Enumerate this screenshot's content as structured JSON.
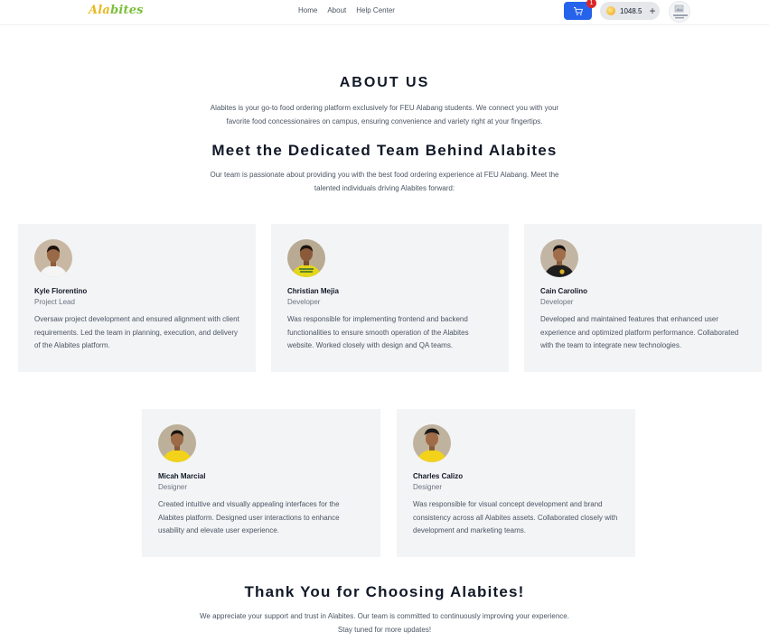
{
  "header": {
    "logo": {
      "part1": "Ala",
      "part2": "bites"
    },
    "nav": [
      "Home",
      "About",
      "Help Center"
    ],
    "cart_badge": "1",
    "coin_balance": "1048.5",
    "plus_symbol": "+"
  },
  "about": {
    "title": "ABOUT US",
    "text": "Alabites is your go-to food ordering platform exclusively for FEU Alabang students. We connect you with your favorite food concessionaires on campus, ensuring convenience and variety right at your fingertips."
  },
  "team": {
    "title": "Meet the Dedicated Team Behind Alabites",
    "text": "Our team is passionate about providing you with the best food ordering experience at FEU Alabang. Meet the talented individuals driving Alabites forward:",
    "members": [
      {
        "name": "Kyle Florentino",
        "role": "Project Lead",
        "description": "Oversaw project development and ensured alignment with client requirements. Led the team in planning, execution, and delivery of the Alabites platform.",
        "shirt_color": "#f5f5f5"
      },
      {
        "name": "Christian Mejia",
        "role": "Developer",
        "description": "Was responsible for implementing frontend and backend functionalities to ensure smooth operation of the Alabites website. Worked closely with design and QA teams.",
        "shirt_color": "#e6d619"
      },
      {
        "name": "Cain Carolino",
        "role": "Developer",
        "description": "Developed and maintained features that enhanced user experience and optimized platform performance. Collaborated with the team to integrate new technologies.",
        "shirt_color": "#1f1f1f"
      },
      {
        "name": "Micah Marcial",
        "role": "Designer",
        "description": "Created intuitive and visually appealing interfaces for the Alabites platform. Designed user interactions to enhance usability and elevate user experience.",
        "shirt_color": "#f2d21a"
      },
      {
        "name": "Charles Calizo",
        "role": "Designer",
        "description": "Was responsible for visual concept development and brand consistency across all Alabites assets. Collaborated closely with development and marketing teams.",
        "shirt_color": "#f2d21a"
      }
    ]
  },
  "thanks": {
    "title": "Thank You for Choosing Alabites!",
    "text": "We appreciate your support and trust in Alabites. Our team is committed to continuously improving your experience. Stay tuned for more updates!"
  },
  "colors": {
    "primary": "#2563eb",
    "badge": "#dc2626",
    "card_bg": "#f3f4f6",
    "logo_gold": "#e8b923",
    "logo_green": "#7bbf3a"
  },
  "icons": [
    "cart-icon",
    "coin-icon",
    "plus-icon",
    "profile-avatar"
  ]
}
